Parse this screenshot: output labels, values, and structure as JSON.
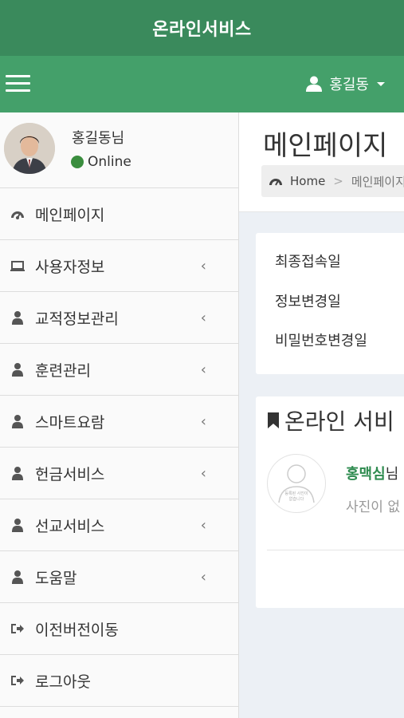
{
  "app": {
    "title": "온라인서비스"
  },
  "navbar": {
    "user_name": "홍길동"
  },
  "profile": {
    "name": "홍길동님",
    "status": "Online",
    "status_color": "#3a8d3e"
  },
  "sidebar": {
    "items": [
      {
        "label": "메인페이지",
        "icon": "dashboard-icon",
        "has_chevron": false
      },
      {
        "label": "사용자정보",
        "icon": "laptop-icon",
        "has_chevron": true
      },
      {
        "label": "교적정보관리",
        "icon": "user-icon",
        "has_chevron": true
      },
      {
        "label": "훈련관리",
        "icon": "user-icon",
        "has_chevron": true
      },
      {
        "label": "스마트요람",
        "icon": "user-icon",
        "has_chevron": true
      },
      {
        "label": "헌금서비스",
        "icon": "user-icon",
        "has_chevron": true
      },
      {
        "label": "선교서비스",
        "icon": "user-icon",
        "has_chevron": true
      },
      {
        "label": "도움말",
        "icon": "user-icon",
        "has_chevron": true
      },
      {
        "label": "이전버전이동",
        "icon": "sign-out-icon",
        "has_chevron": false
      },
      {
        "label": "로그아웃",
        "icon": "sign-out-icon",
        "has_chevron": false
      }
    ],
    "chevron": "‹"
  },
  "main": {
    "page_title": "메인페이지",
    "breadcrumb": {
      "home": "Home",
      "separator": ">",
      "current": "메인페이지"
    },
    "info_rows": [
      "최종접속일",
      "정보변경일",
      "비밀번호변경일"
    ],
    "service": {
      "title": "온라인 서비",
      "name": "홍맥심",
      "name_suffix": "님",
      "subtext": "사진이 없",
      "photo_caption_1": "등록된 사진이",
      "photo_caption_2": "없습니다"
    }
  },
  "colors": {
    "topbar": "#3a8a5c",
    "navbar": "#44a06a",
    "accent": "#2e8b4f"
  }
}
